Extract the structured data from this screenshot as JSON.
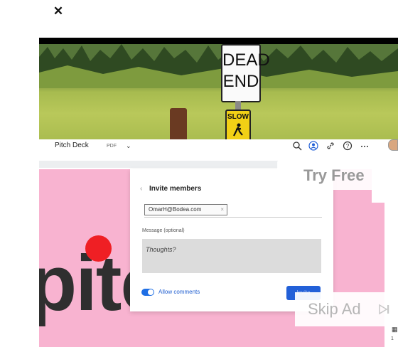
{
  "close": {
    "glyph": "✕"
  },
  "photo": {
    "sign_line1": "DEAD",
    "sign_line2": "END",
    "slow_sign": "SLOW"
  },
  "app": {
    "title": "Pitch Deck",
    "badge": "PDF",
    "chevron": "⌄",
    "toolbar_icons": [
      "search-icon",
      "add-user-icon",
      "link-icon",
      "help-icon",
      "more-icon"
    ]
  },
  "dialog": {
    "back": "‹",
    "title": "Invite members",
    "email_chip": "OmarH@Bodea.com",
    "chip_remove": "×",
    "message_label": "Message (optional)",
    "message_placeholder": "Thoughts?",
    "allow_comments": "Allow comments",
    "invite_button": "Invite"
  },
  "slide": {
    "big_text": "pitch"
  },
  "ad": {
    "try_free": "Try Free",
    "skip_ad": "Skip Ad"
  },
  "colors": {
    "pink": "#f8b3d0",
    "red_dot": "#ef1f24",
    "accent_blue": "#2260d8"
  }
}
